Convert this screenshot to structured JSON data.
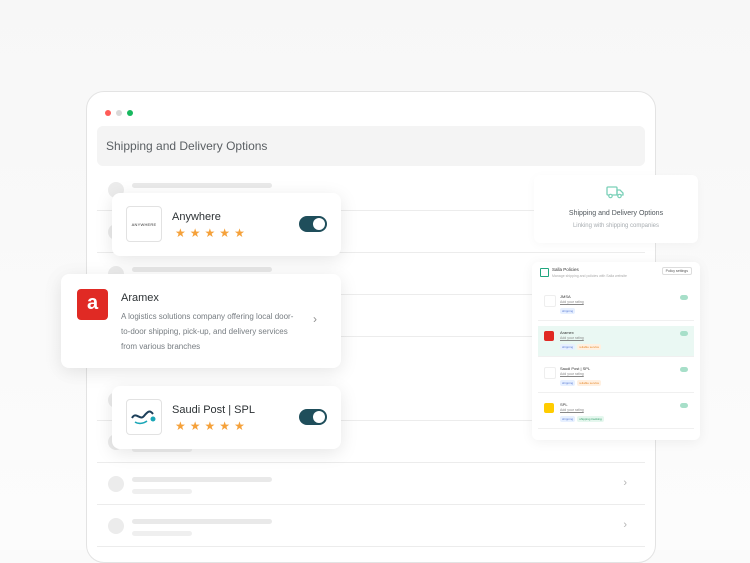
{
  "window": {
    "title": "Shipping and Delivery Options"
  },
  "cards": {
    "anywhere": {
      "name": "Anywhere",
      "logo_text": "ANYWHERE",
      "rating": 5,
      "enabled": true
    },
    "aramex": {
      "name": "Aramex",
      "description": "A logistics solutions company offering local door-to-door shipping, pick-up, and delivery services from various branches"
    },
    "spl": {
      "name": "Saudi Post | SPL",
      "rating": 5,
      "enabled": true
    }
  },
  "side_panel": {
    "title": "Shipping and Delivery Options",
    "subtitle": "Linking with shipping companies"
  },
  "mini_panel": {
    "title": "Salla Policies",
    "subtitle": "Manage shipping and policies with Salla website",
    "button": "Policy settings",
    "rows": [
      {
        "name": "JMSA",
        "link": "Add your rating",
        "tags": [
          "shipping"
        ]
      },
      {
        "name": "Aramex",
        "link": "Add your rating",
        "tags": [
          "shipping",
          "reliable service"
        ]
      },
      {
        "name": "Saudi Post | SPL",
        "link": "Add your rating",
        "tags": [
          "shipping",
          "reliable service"
        ]
      },
      {
        "name": "SPL",
        "link": "Add your rating",
        "tags": [
          "shipping",
          "shipping tracking"
        ]
      }
    ]
  },
  "colors": {
    "toggle": "#1f4e5b",
    "star": "#f5a13a",
    "aramex": "#e02a24",
    "accent_green": "#20a67f"
  }
}
